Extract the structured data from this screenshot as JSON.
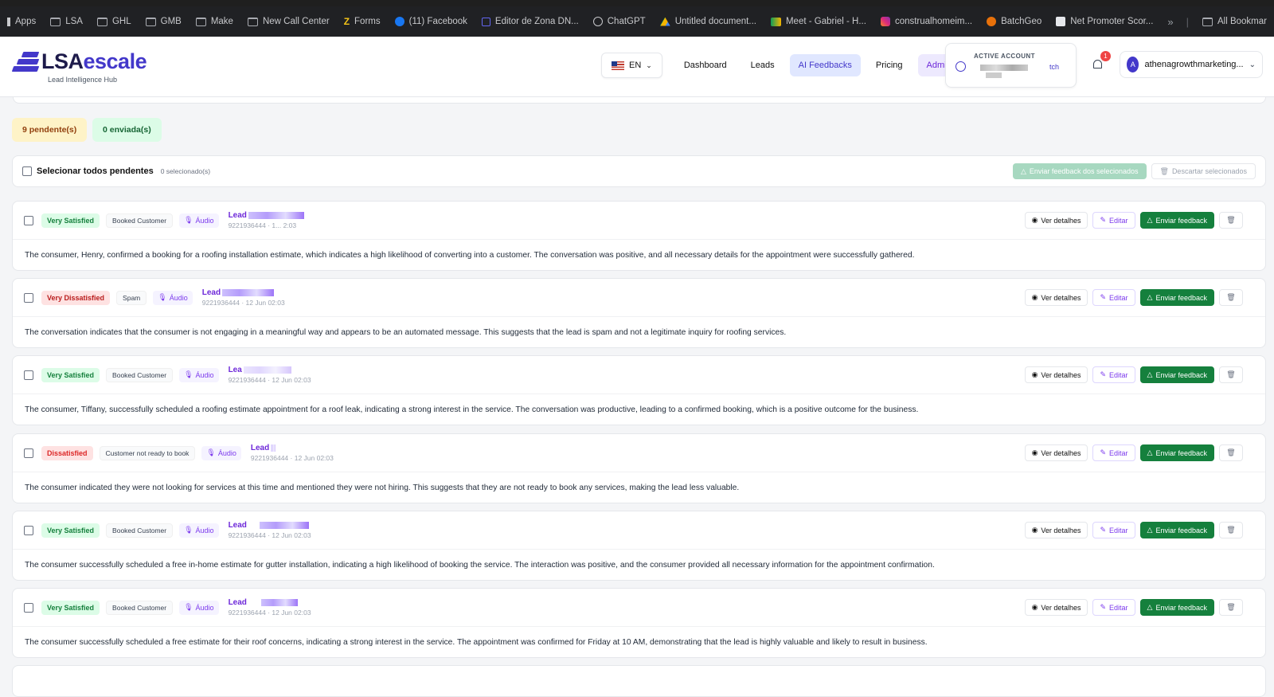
{
  "bookmarks": {
    "items": [
      {
        "label": "Apps",
        "icon": "apps-grid-icon"
      },
      {
        "label": "LSA",
        "icon": "folder-icon"
      },
      {
        "label": "GHL",
        "icon": "folder-icon"
      },
      {
        "label": "GMB",
        "icon": "folder-icon"
      },
      {
        "label": "Make",
        "icon": "folder-icon"
      },
      {
        "label": "New Call Center",
        "icon": "folder-icon"
      },
      {
        "label": "Forms",
        "icon": "forms-icon"
      },
      {
        "label": "(11) Facebook",
        "icon": "facebook-icon"
      },
      {
        "label": "Editor de Zona DN...",
        "icon": "editor-icon"
      },
      {
        "label": "ChatGPT",
        "icon": "chatgpt-icon"
      },
      {
        "label": "Untitled document...",
        "icon": "drive-icon"
      },
      {
        "label": "Meet - Gabriel - H...",
        "icon": "meet-icon"
      },
      {
        "label": "construalhomeim...",
        "icon": "instagram-icon"
      },
      {
        "label": "BatchGeo",
        "icon": "batchgeo-icon"
      },
      {
        "label": "Net Promoter Scor...",
        "icon": "nps-icon"
      }
    ],
    "overflow": "»",
    "all_bookmarks": "All Bookmar"
  },
  "header": {
    "logo_main": "LSA",
    "logo_accent": "escale",
    "logo_sub": "Lead Intelligence Hub",
    "lang": "EN",
    "nav": [
      {
        "label": "Dashboard"
      },
      {
        "label": "Leads"
      },
      {
        "label": "AI Feedbacks",
        "active": true
      },
      {
        "label": "Pricing"
      },
      {
        "label": "Admin"
      }
    ],
    "account_label": "ACTIVE ACCOUNT",
    "account_switch": "tch",
    "notifications": "1",
    "user_initial": "A",
    "user_email": "athenagrowthmarketing..."
  },
  "counts": {
    "pending": "9 pendente(s)",
    "sent": "0 enviada(s)"
  },
  "select_bar": {
    "label": "Selecionar todos pendentes",
    "selected": "0 selecionado(s)",
    "send_selected": "Enviar feedback dos selecionados",
    "discard_selected": "Descartar selecionados"
  },
  "actions": {
    "details": "Ver detalhes",
    "edit": "Editar",
    "send": "Enviar feedback"
  },
  "cards": [
    {
      "satisfaction": "Very Satisfied",
      "sat_class": "vs",
      "category": "Booked Customer",
      "audio": "Áudio",
      "lead": "Lead",
      "sub": "9221936444 · 1... 2:03",
      "text": "The consumer, Henry, confirmed a booking for a roofing installation estimate, which indicates a high likelihood of converting into a customer. The conversation was positive, and all necessary details for the appointment were successfully gathered."
    },
    {
      "satisfaction": "Very Dissatisfied",
      "sat_class": "vd",
      "category": "Spam",
      "audio": "Áudio",
      "lead": "Lead",
      "sub": "9221936444 · 12 Jun 02:03",
      "text": "The conversation indicates that the consumer is not engaging in a meaningful way and appears to be an automated message. This suggests that the lead is spam and not a legitimate inquiry for roofing services."
    },
    {
      "satisfaction": "Very Satisfied",
      "sat_class": "vs",
      "category": "Booked Customer",
      "audio": "Áudio",
      "lead": "Lea",
      "sub": "9221936444 · 12 Jun 02:03",
      "text": "The consumer, Tiffany, successfully scheduled a roofing estimate appointment for a roof leak, indicating a strong interest in the service. The conversation was productive, leading to a confirmed booking, which is a positive outcome for the business."
    },
    {
      "satisfaction": "Dissatisfied",
      "sat_class": "d",
      "category": "Customer not ready to book",
      "audio": "Áudio",
      "lead": "Lead",
      "sub": "9221936444 · 12 Jun 02:03",
      "text": "The consumer indicated they were not looking for services at this time and mentioned they were not hiring. This suggests that they are not ready to book any services, making the lead less valuable."
    },
    {
      "satisfaction": "Very Satisfied",
      "sat_class": "vs",
      "category": "Booked Customer",
      "audio": "Áudio",
      "lead": "Lead",
      "sub": "9221936444 · 12 Jun 02:03",
      "text": "The consumer successfully scheduled a free in-home estimate for gutter installation, indicating a high likelihood of booking the service. The interaction was positive, and the consumer provided all necessary information for the appointment confirmation."
    },
    {
      "satisfaction": "Very Satisfied",
      "sat_class": "vs",
      "category": "Booked Customer",
      "audio": "Áudio",
      "lead": "Lead",
      "sub": "9221936444 · 12 Jun 02:03",
      "text": "The consumer successfully scheduled a free estimate for their roof concerns, indicating a strong interest in the service. The appointment was confirmed for Friday at 10 AM, demonstrating that the lead is highly valuable and likely to result in business."
    }
  ]
}
